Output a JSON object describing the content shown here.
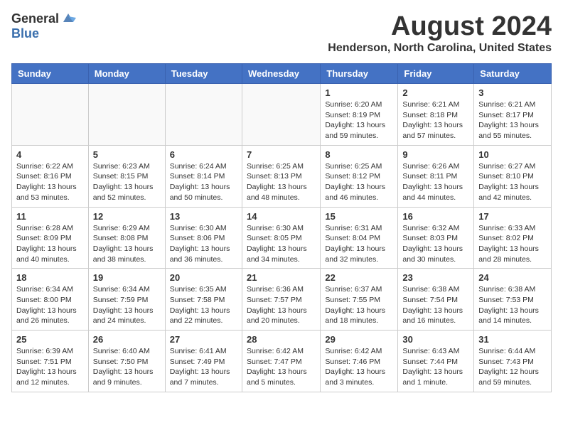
{
  "header": {
    "logo_general": "General",
    "logo_blue": "Blue",
    "month_year": "August 2024",
    "location": "Henderson, North Carolina, United States"
  },
  "columns": [
    "Sunday",
    "Monday",
    "Tuesday",
    "Wednesday",
    "Thursday",
    "Friday",
    "Saturday"
  ],
  "weeks": [
    [
      {
        "day": "",
        "content": ""
      },
      {
        "day": "",
        "content": ""
      },
      {
        "day": "",
        "content": ""
      },
      {
        "day": "",
        "content": ""
      },
      {
        "day": "1",
        "content": "Sunrise: 6:20 AM\nSunset: 8:19 PM\nDaylight: 13 hours\nand 59 minutes."
      },
      {
        "day": "2",
        "content": "Sunrise: 6:21 AM\nSunset: 8:18 PM\nDaylight: 13 hours\nand 57 minutes."
      },
      {
        "day": "3",
        "content": "Sunrise: 6:21 AM\nSunset: 8:17 PM\nDaylight: 13 hours\nand 55 minutes."
      }
    ],
    [
      {
        "day": "4",
        "content": "Sunrise: 6:22 AM\nSunset: 8:16 PM\nDaylight: 13 hours\nand 53 minutes."
      },
      {
        "day": "5",
        "content": "Sunrise: 6:23 AM\nSunset: 8:15 PM\nDaylight: 13 hours\nand 52 minutes."
      },
      {
        "day": "6",
        "content": "Sunrise: 6:24 AM\nSunset: 8:14 PM\nDaylight: 13 hours\nand 50 minutes."
      },
      {
        "day": "7",
        "content": "Sunrise: 6:25 AM\nSunset: 8:13 PM\nDaylight: 13 hours\nand 48 minutes."
      },
      {
        "day": "8",
        "content": "Sunrise: 6:25 AM\nSunset: 8:12 PM\nDaylight: 13 hours\nand 46 minutes."
      },
      {
        "day": "9",
        "content": "Sunrise: 6:26 AM\nSunset: 8:11 PM\nDaylight: 13 hours\nand 44 minutes."
      },
      {
        "day": "10",
        "content": "Sunrise: 6:27 AM\nSunset: 8:10 PM\nDaylight: 13 hours\nand 42 minutes."
      }
    ],
    [
      {
        "day": "11",
        "content": "Sunrise: 6:28 AM\nSunset: 8:09 PM\nDaylight: 13 hours\nand 40 minutes."
      },
      {
        "day": "12",
        "content": "Sunrise: 6:29 AM\nSunset: 8:08 PM\nDaylight: 13 hours\nand 38 minutes."
      },
      {
        "day": "13",
        "content": "Sunrise: 6:30 AM\nSunset: 8:06 PM\nDaylight: 13 hours\nand 36 minutes."
      },
      {
        "day": "14",
        "content": "Sunrise: 6:30 AM\nSunset: 8:05 PM\nDaylight: 13 hours\nand 34 minutes."
      },
      {
        "day": "15",
        "content": "Sunrise: 6:31 AM\nSunset: 8:04 PM\nDaylight: 13 hours\nand 32 minutes."
      },
      {
        "day": "16",
        "content": "Sunrise: 6:32 AM\nSunset: 8:03 PM\nDaylight: 13 hours\nand 30 minutes."
      },
      {
        "day": "17",
        "content": "Sunrise: 6:33 AM\nSunset: 8:02 PM\nDaylight: 13 hours\nand 28 minutes."
      }
    ],
    [
      {
        "day": "18",
        "content": "Sunrise: 6:34 AM\nSunset: 8:00 PM\nDaylight: 13 hours\nand 26 minutes."
      },
      {
        "day": "19",
        "content": "Sunrise: 6:34 AM\nSunset: 7:59 PM\nDaylight: 13 hours\nand 24 minutes."
      },
      {
        "day": "20",
        "content": "Sunrise: 6:35 AM\nSunset: 7:58 PM\nDaylight: 13 hours\nand 22 minutes."
      },
      {
        "day": "21",
        "content": "Sunrise: 6:36 AM\nSunset: 7:57 PM\nDaylight: 13 hours\nand 20 minutes."
      },
      {
        "day": "22",
        "content": "Sunrise: 6:37 AM\nSunset: 7:55 PM\nDaylight: 13 hours\nand 18 minutes."
      },
      {
        "day": "23",
        "content": "Sunrise: 6:38 AM\nSunset: 7:54 PM\nDaylight: 13 hours\nand 16 minutes."
      },
      {
        "day": "24",
        "content": "Sunrise: 6:38 AM\nSunset: 7:53 PM\nDaylight: 13 hours\nand 14 minutes."
      }
    ],
    [
      {
        "day": "25",
        "content": "Sunrise: 6:39 AM\nSunset: 7:51 PM\nDaylight: 13 hours\nand 12 minutes."
      },
      {
        "day": "26",
        "content": "Sunrise: 6:40 AM\nSunset: 7:50 PM\nDaylight: 13 hours\nand 9 minutes."
      },
      {
        "day": "27",
        "content": "Sunrise: 6:41 AM\nSunset: 7:49 PM\nDaylight: 13 hours\nand 7 minutes."
      },
      {
        "day": "28",
        "content": "Sunrise: 6:42 AM\nSunset: 7:47 PM\nDaylight: 13 hours\nand 5 minutes."
      },
      {
        "day": "29",
        "content": "Sunrise: 6:42 AM\nSunset: 7:46 PM\nDaylight: 13 hours\nand 3 minutes."
      },
      {
        "day": "30",
        "content": "Sunrise: 6:43 AM\nSunset: 7:44 PM\nDaylight: 13 hours\nand 1 minute."
      },
      {
        "day": "31",
        "content": "Sunrise: 6:44 AM\nSunset: 7:43 PM\nDaylight: 12 hours\nand 59 minutes."
      }
    ]
  ]
}
